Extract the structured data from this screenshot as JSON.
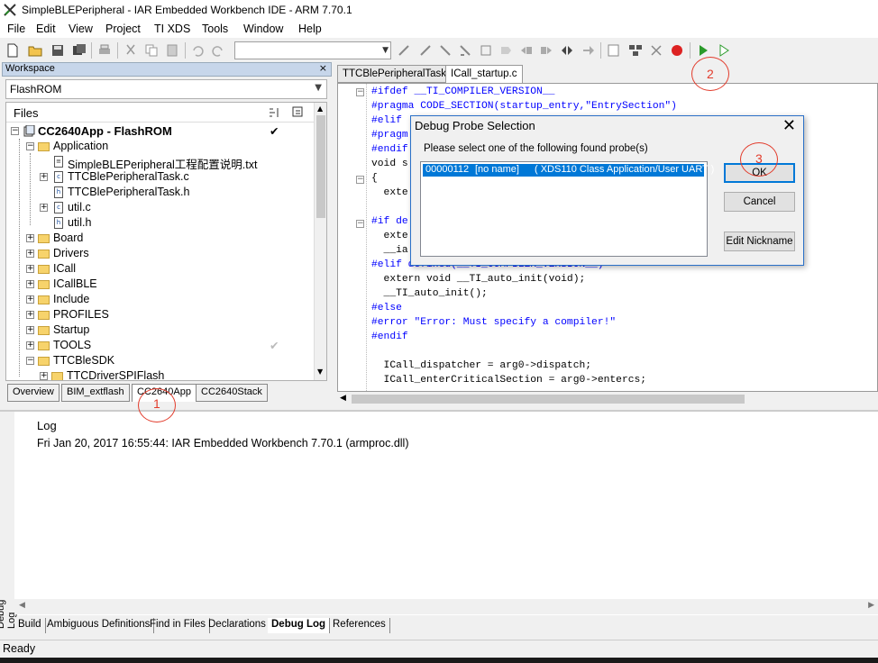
{
  "window": {
    "title": "SimpleBLEPeripheral - IAR Embedded Workbench IDE - ARM 7.70.1"
  },
  "menu": [
    "File",
    "Edit",
    "View",
    "Project",
    "TI XDS",
    "Tools",
    "Window",
    "Help"
  ],
  "workspace": {
    "panel_title": "Workspace",
    "close": "×",
    "config": "FlashROM",
    "files_header": "Files",
    "tree": [
      {
        "label": "CC2640App - FlashROM",
        "bold": true
      },
      {
        "label": "Application"
      },
      {
        "label": "SimpleBLEPeripheral工程配置说明.txt"
      },
      {
        "label": "TTCBlePeripheralTask.c"
      },
      {
        "label": "TTCBlePeripheralTask.h"
      },
      {
        "label": "util.c"
      },
      {
        "label": "util.h"
      },
      {
        "label": "Board"
      },
      {
        "label": "Drivers"
      },
      {
        "label": "ICall"
      },
      {
        "label": "ICallBLE"
      },
      {
        "label": "Include"
      },
      {
        "label": "PROFILES"
      },
      {
        "label": "Startup"
      },
      {
        "label": "TOOLS"
      },
      {
        "label": "TTCBleSDK"
      },
      {
        "label": "TTCDriverSPIFlash"
      }
    ],
    "tabs": [
      "Overview",
      "BIM_extflash",
      "CC2640App",
      "CC2640Stack"
    ]
  },
  "editor": {
    "tabs": [
      "TTCBlePeripheralTask.c",
      "ICall_startup.c"
    ],
    "code": [
      "#ifdef __TI_COMPILER_VERSION__",
      "#pragma CODE_SECTION(startup_entry,\"EntrySection\")",
      "#elif",
      "#pragm",
      "#endif",
      "void s",
      "{",
      "  exte",
      "",
      "#if de",
      "  exte",
      "  __ia",
      "#elif defined(__TI_COMPILER_VERSION__)",
      "  extern void __TI_auto_init(void);",
      "  __TI_auto_init();",
      "#else",
      "#error \"Error: Must specify a compiler!\"",
      "#endif",
      "",
      "  ICall_dispatcher = arg0->dispatch;",
      "  ICall_enterCriticalSection = arg0->entercs;"
    ]
  },
  "dialog": {
    "title": "Debug Probe Selection",
    "close": "✕",
    "prompt": "Please select one of the following found probe(s)",
    "probe_id": "00000112",
    "probe_name": "[no name]",
    "probe_desc": "( XDS110 Class Application/User UART )",
    "ok": "OK",
    "cancel": "Cancel",
    "edit_nickname": "Edit Nickname"
  },
  "log": {
    "side_label": "Debug Log",
    "header": "Log",
    "line": "Fri Jan 20, 2017 16:55:44: IAR Embedded Workbench 7.70.1 (armproc.dll)",
    "tabs": [
      "Build",
      "Ambiguous Definitions",
      "Find in Files",
      "Declarations",
      "Debug Log",
      "References"
    ]
  },
  "status": "Ready",
  "annotations": [
    "1",
    "2",
    "3"
  ],
  "colors": {
    "annotation": "#e23b2b",
    "selection": "#0078d7",
    "keyword": "#0000ff"
  }
}
